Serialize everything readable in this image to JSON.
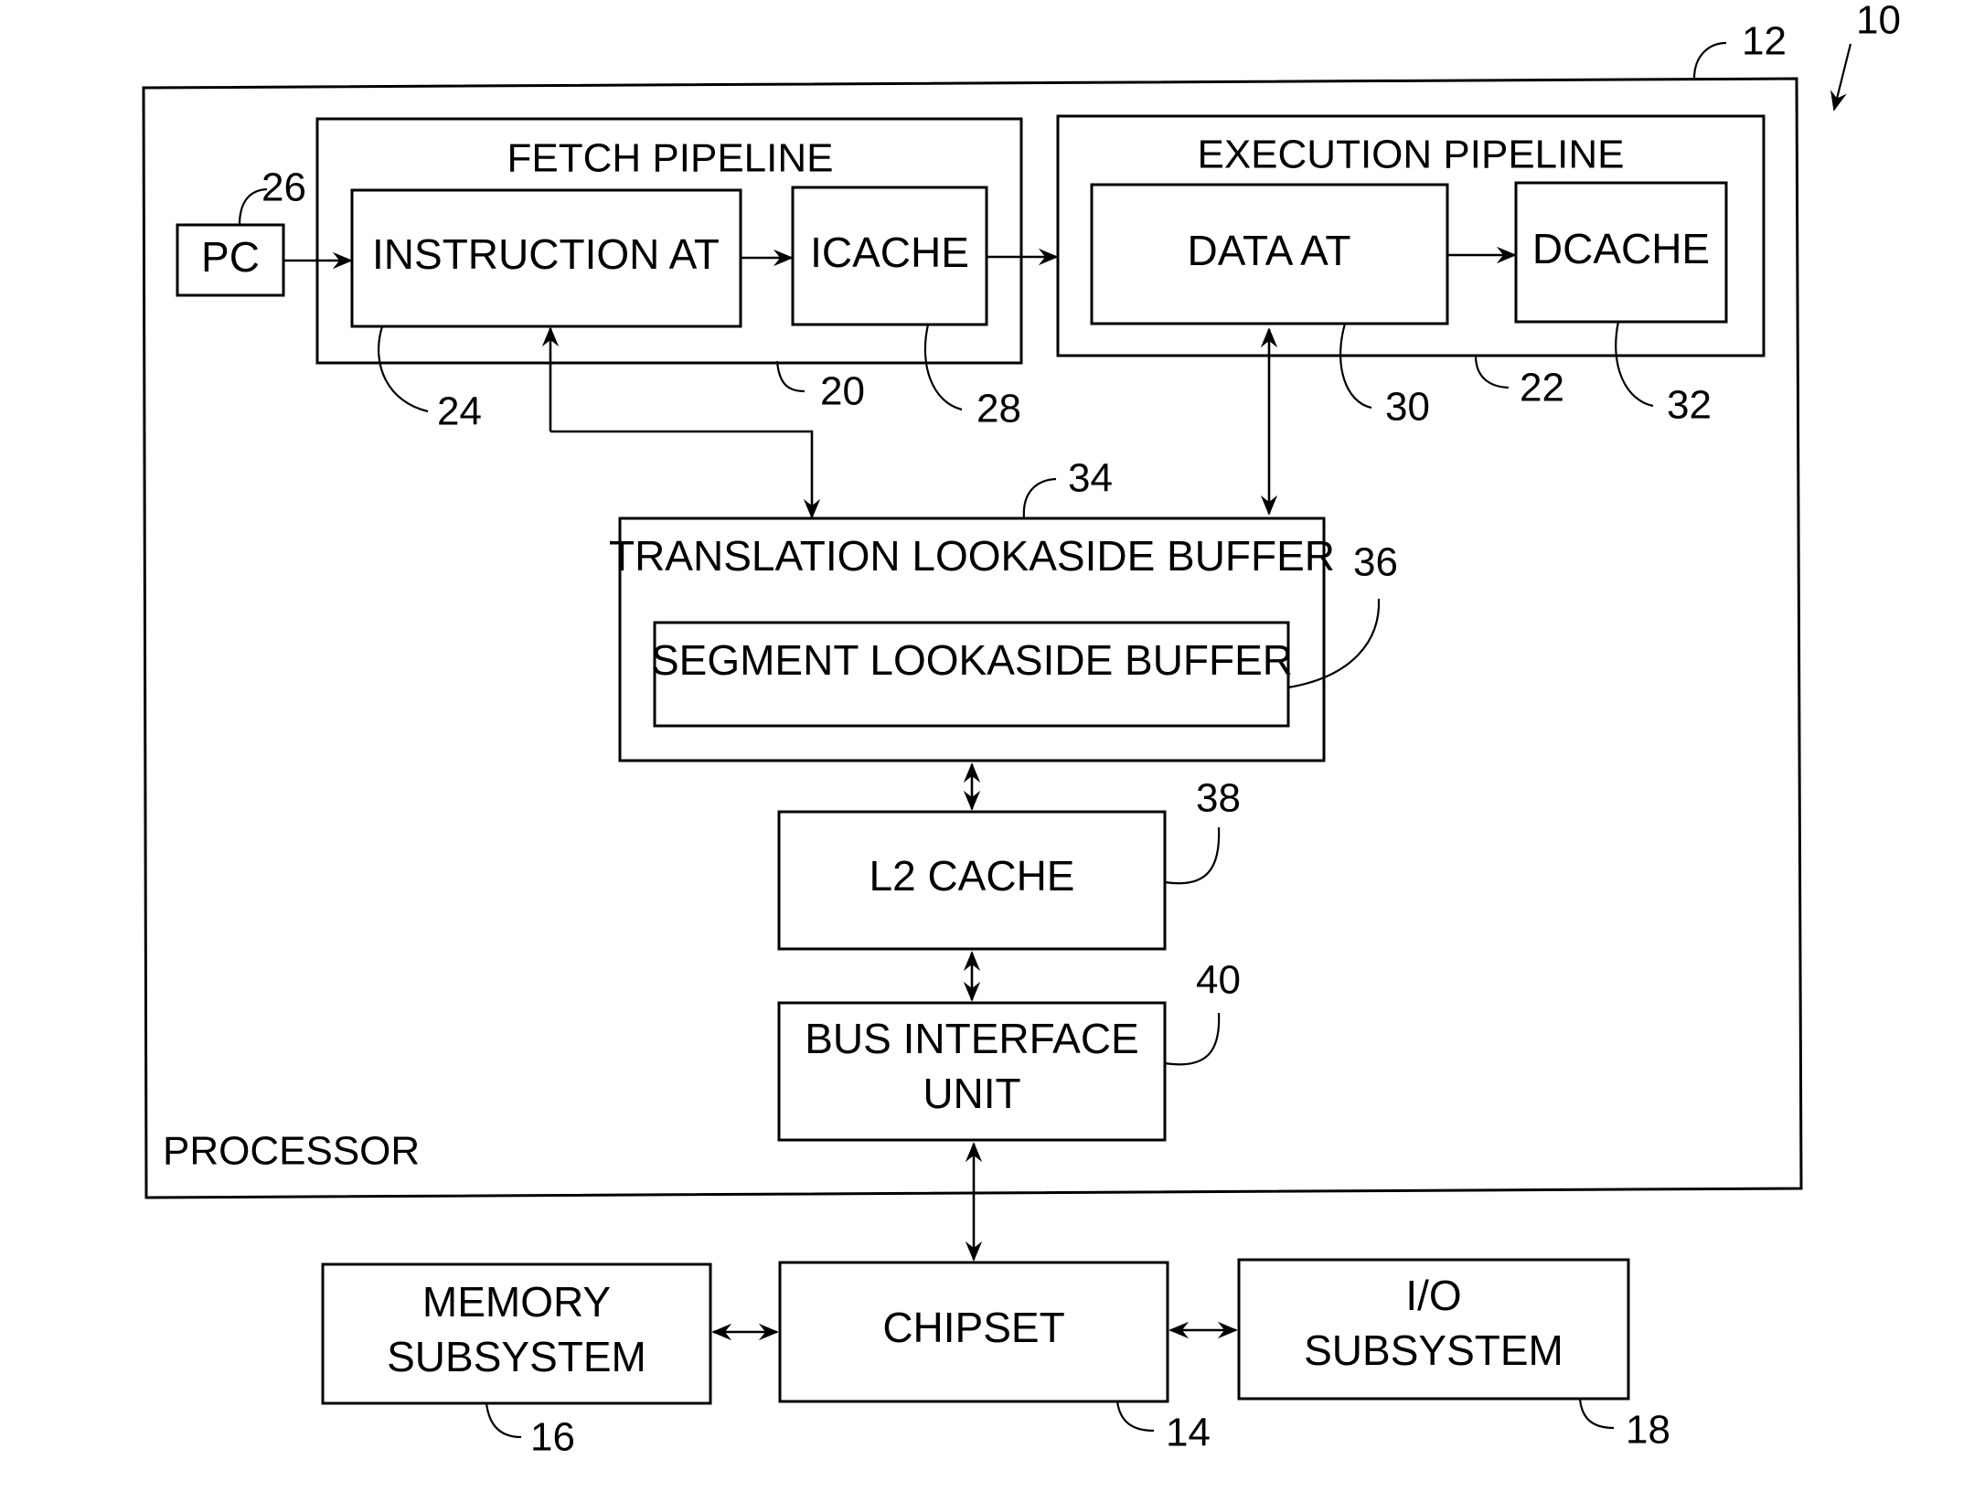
{
  "figure": {
    "system_ref": "10",
    "processor": {
      "label": "PROCESSOR",
      "ref": "12"
    },
    "fetch_pipeline": {
      "title": "FETCH PIPELINE",
      "ref": "20"
    },
    "execution_pipeline": {
      "title": "EXECUTION PIPELINE",
      "ref": "22"
    },
    "pc": {
      "label": "PC",
      "ref": "26"
    },
    "instruction_at": {
      "label": "INSTRUCTION AT",
      "ref": "24"
    },
    "icache": {
      "label": "ICACHE",
      "ref": "28"
    },
    "data_at": {
      "label": "DATA AT",
      "ref": "30"
    },
    "dcache": {
      "label": "DCACHE",
      "ref": "32"
    },
    "tlb": {
      "label": "TRANSLATION LOOKASIDE BUFFER",
      "ref": "34"
    },
    "slb": {
      "label": "SEGMENT LOOKASIDE BUFFER",
      "ref": "36"
    },
    "l2_cache": {
      "label": "L2 CACHE",
      "ref": "38"
    },
    "biu": {
      "label_line1": "BUS INTERFACE",
      "label_line2": "UNIT",
      "ref": "40"
    },
    "chipset": {
      "label": "CHIPSET",
      "ref": "14"
    },
    "memory": {
      "label_line1": "MEMORY",
      "label_line2": "SUBSYSTEM",
      "ref": "16"
    },
    "io": {
      "label_line1": "I/O",
      "label_line2": "SUBSYSTEM",
      "ref": "18"
    }
  }
}
